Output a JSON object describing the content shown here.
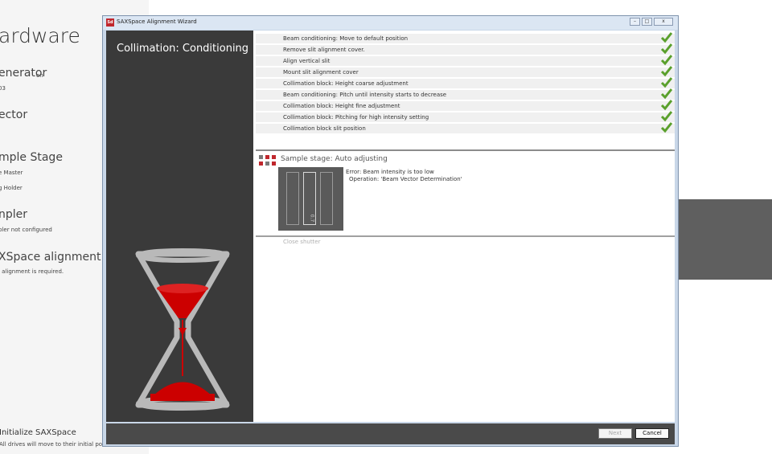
{
  "background": {
    "heading": "ardware",
    "sections": [
      {
        "title": "enerator",
        "suffix": "on",
        "sub": "03"
      },
      {
        "title": "ector"
      },
      {
        "title": "mple Stage",
        "items": [
          "e Master",
          "g Holder"
        ]
      },
      {
        "title": "npler",
        "sub": "pler not configured"
      },
      {
        "title": "XSpace alignment",
        "sub": "l alignment is required."
      }
    ],
    "init_title": "Initialize SAXSpace",
    "init_sub": "All drives will move to their initial position."
  },
  "window": {
    "title": "SAXSpace Alignment Wizard",
    "icon_label": "Sd",
    "controls": {
      "minimize": "–",
      "maximize": "□",
      "close": "x"
    }
  },
  "left_panel": {
    "stage_title": "Collimation: Conditioning",
    "hourglass_icon": "hourglass-icon"
  },
  "steps": [
    {
      "label": "Beam conditioning: Move to default position",
      "done": true
    },
    {
      "label": "Remove slit alignment cover.",
      "done": true
    },
    {
      "label": "Align vertical slit",
      "done": true
    },
    {
      "label": "Mount slit alignment cover",
      "done": true
    },
    {
      "label": "Collimation block: Height coarse adjustment",
      "done": true
    },
    {
      "label": "Beam conditioning: Pitch until intensity starts to decrease",
      "done": true
    },
    {
      "label": "Collimation block: Height fine adjustment",
      "done": true
    },
    {
      "label": "Collimation block: Pitching for high intensity setting",
      "done": true
    },
    {
      "label": "Collimation block slit position",
      "done": true
    }
  ],
  "current_step": {
    "title": "Sample stage: Auto adjusting",
    "error_line1": "Error: Beam intensity is too low",
    "error_line2": "Operation: 'Beam Vector Determination'",
    "slit_label": "0.7"
  },
  "next_step": {
    "label": "Close shutter"
  },
  "buttons": {
    "next": "Next",
    "cancel": "Cancel"
  },
  "colors": {
    "check": "#5aa02c",
    "hourglass_sand": "#cc0000",
    "panel": "#3a3a3a",
    "accent": "#c0272d"
  }
}
